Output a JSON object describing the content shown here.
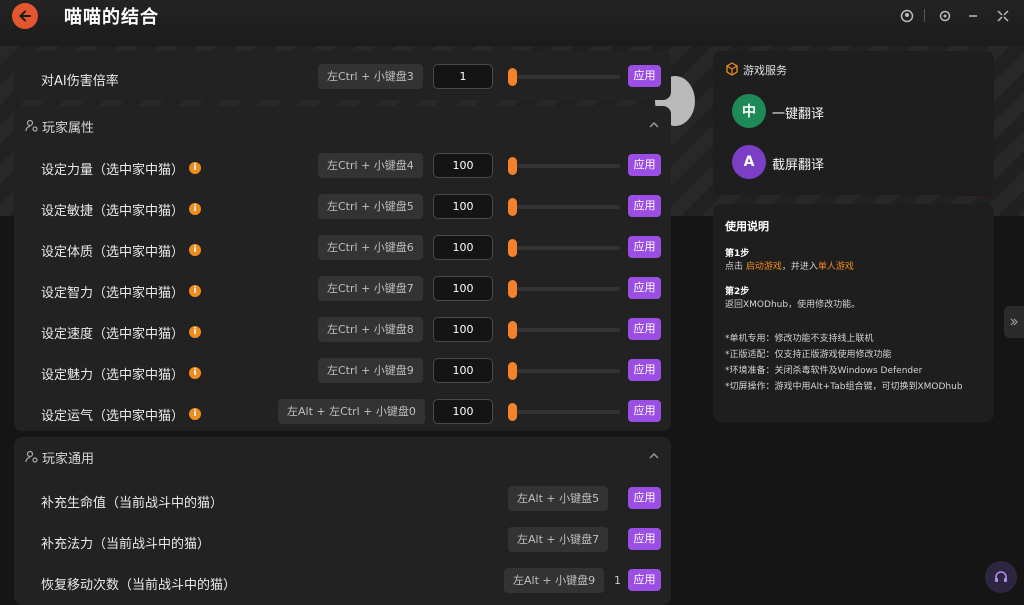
{
  "header": {
    "title": "喵喵的结合"
  },
  "panel_top": {
    "row": {
      "label": "对AI伤害倍率",
      "hotkey": "左Ctrl + 小键盘3",
      "value": "1",
      "slider_level": 0,
      "apply": "应用"
    }
  },
  "player_attrs": {
    "title": "玩家属性",
    "rows": [
      {
        "label": "设定力量（选中家中猫）",
        "hotkey": "左Ctrl + 小键盘4",
        "value": "100",
        "apply": "应用"
      },
      {
        "label": "设定敏捷（选中家中猫）",
        "hotkey": "左Ctrl + 小键盘5",
        "value": "100",
        "apply": "应用"
      },
      {
        "label": "设定体质（选中家中猫）",
        "hotkey": "左Ctrl + 小键盘6",
        "value": "100",
        "apply": "应用"
      },
      {
        "label": "设定智力（选中家中猫）",
        "hotkey": "左Ctrl + 小键盘7",
        "value": "100",
        "apply": "应用"
      },
      {
        "label": "设定速度（选中家中猫）",
        "hotkey": "左Ctrl + 小键盘8",
        "value": "100",
        "apply": "应用"
      },
      {
        "label": "设定魅力（选中家中猫）",
        "hotkey": "左Ctrl + 小键盘9",
        "value": "100",
        "apply": "应用"
      },
      {
        "label": "设定运气（选中家中猫）",
        "hotkey": "左Alt + 左Ctrl + 小键盘0",
        "value": "100",
        "apply": "应用"
      }
    ]
  },
  "player_general": {
    "title": "玩家通用",
    "rows": [
      {
        "label": "补充生命值（当前战斗中的猫）",
        "hotkey": "左Alt + 小键盘5",
        "apply": "应用"
      },
      {
        "label": "补充法力（当前战斗中的猫）",
        "hotkey": "左Alt + 小键盘7",
        "apply": "应用"
      },
      {
        "label": "恢复移动次数（当前战斗中的猫）",
        "hotkey": "左Alt + 小键盘9",
        "count": "1",
        "apply": "应用"
      }
    ]
  },
  "services": {
    "title": "游戏服务",
    "items": [
      {
        "name": "一键翻译",
        "glyph": "中"
      },
      {
        "name": "截屏翻译",
        "glyph": "A"
      }
    ]
  },
  "guide": {
    "title": "使用说明",
    "step1_title": "第1步",
    "step1_a": "点击 ",
    "step1_link1": "启动游戏",
    "step1_b": "，并进入",
    "step1_link2": "单人游戏",
    "step2_title": "第2步",
    "step2_text": "返回XMODhub，使用修改功能。",
    "note1": "*单机专用：修改功能不支持线上联机",
    "note2": "*正版适配：仅支持正版游戏使用修改功能",
    "note3": "*环境准备：关闭杀毒软件及Windows Defender",
    "note4": "*切屏操作：游戏中用Alt+Tab组合键，可切换到XMODhub"
  },
  "colors": {
    "accent_orange": "#f5812a",
    "apply_purple": "#9b4ee3",
    "back_red": "#e4572e"
  }
}
